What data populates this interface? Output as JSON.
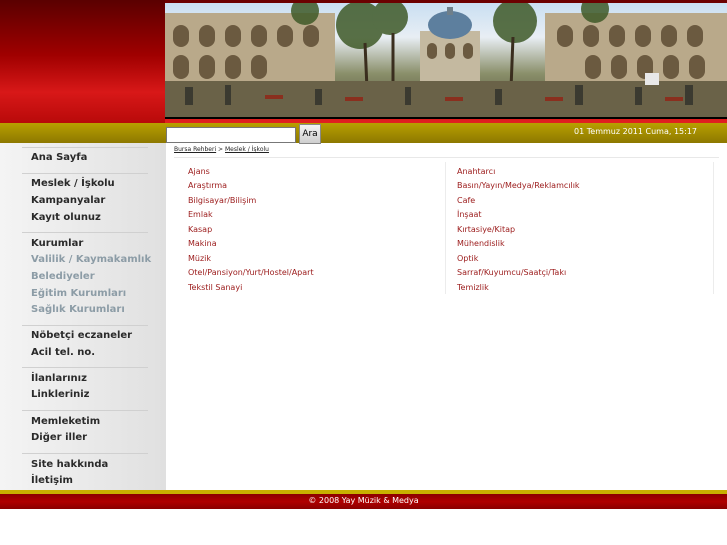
{
  "search": {
    "button_label": "Ara",
    "value": ""
  },
  "date": "01 Temmuz 2011 Cuma, 15:17",
  "sidebar": {
    "items": [
      {
        "label": "Ana Sayfa"
      },
      {
        "label": "Meslek / İşkolu"
      },
      {
        "label": "Kampanyalar"
      },
      {
        "label": "Kayıt olunuz"
      },
      {
        "label": "Kurumlar"
      },
      {
        "label": "Valilik / Kaymakamlık"
      },
      {
        "label": "Belediyeler"
      },
      {
        "label": "Eğitim Kurumları"
      },
      {
        "label": "Sağlık Kurumları"
      },
      {
        "label": "Nöbetçi eczaneler"
      },
      {
        "label": "Acil tel. no."
      },
      {
        "label": "İlanlarınız"
      },
      {
        "label": "Linkleriniz"
      },
      {
        "label": "Memleketim"
      },
      {
        "label": "Diğer iller"
      },
      {
        "label": "Site hakkında"
      },
      {
        "label": "İletişim"
      }
    ]
  },
  "breadcrumb": {
    "root": "Bursa Rehberi",
    "separator": ">",
    "current": "Meslek / İşkolu"
  },
  "categories": {
    "left": [
      "Ajans",
      "Araştırma",
      "Bilgisayar/Bilişim",
      "Emlak",
      "Kasap",
      "Makina",
      "Müzik",
      "Otel/Pansiyon/Yurt/Hostel/Apart",
      "Tekstil Sanayi"
    ],
    "right": [
      "Anahtarcı",
      "Basın/Yayın/Medya/Reklamcılık",
      "Cafe",
      "İnşaat",
      "Kırtasiye/Kitap",
      "Mühendislik",
      "Optik",
      "Sarraf/Kuyumcu/Saatçi/Takı",
      "Temizlik"
    ]
  },
  "footer": {
    "text": "© 2008 Yay Müzik & Medya"
  },
  "colors": {
    "brand_red": "#b00000",
    "bar_gold": "#a08a00",
    "link_red": "#9b1a1a",
    "muted_nav": "#8c9ca6"
  }
}
